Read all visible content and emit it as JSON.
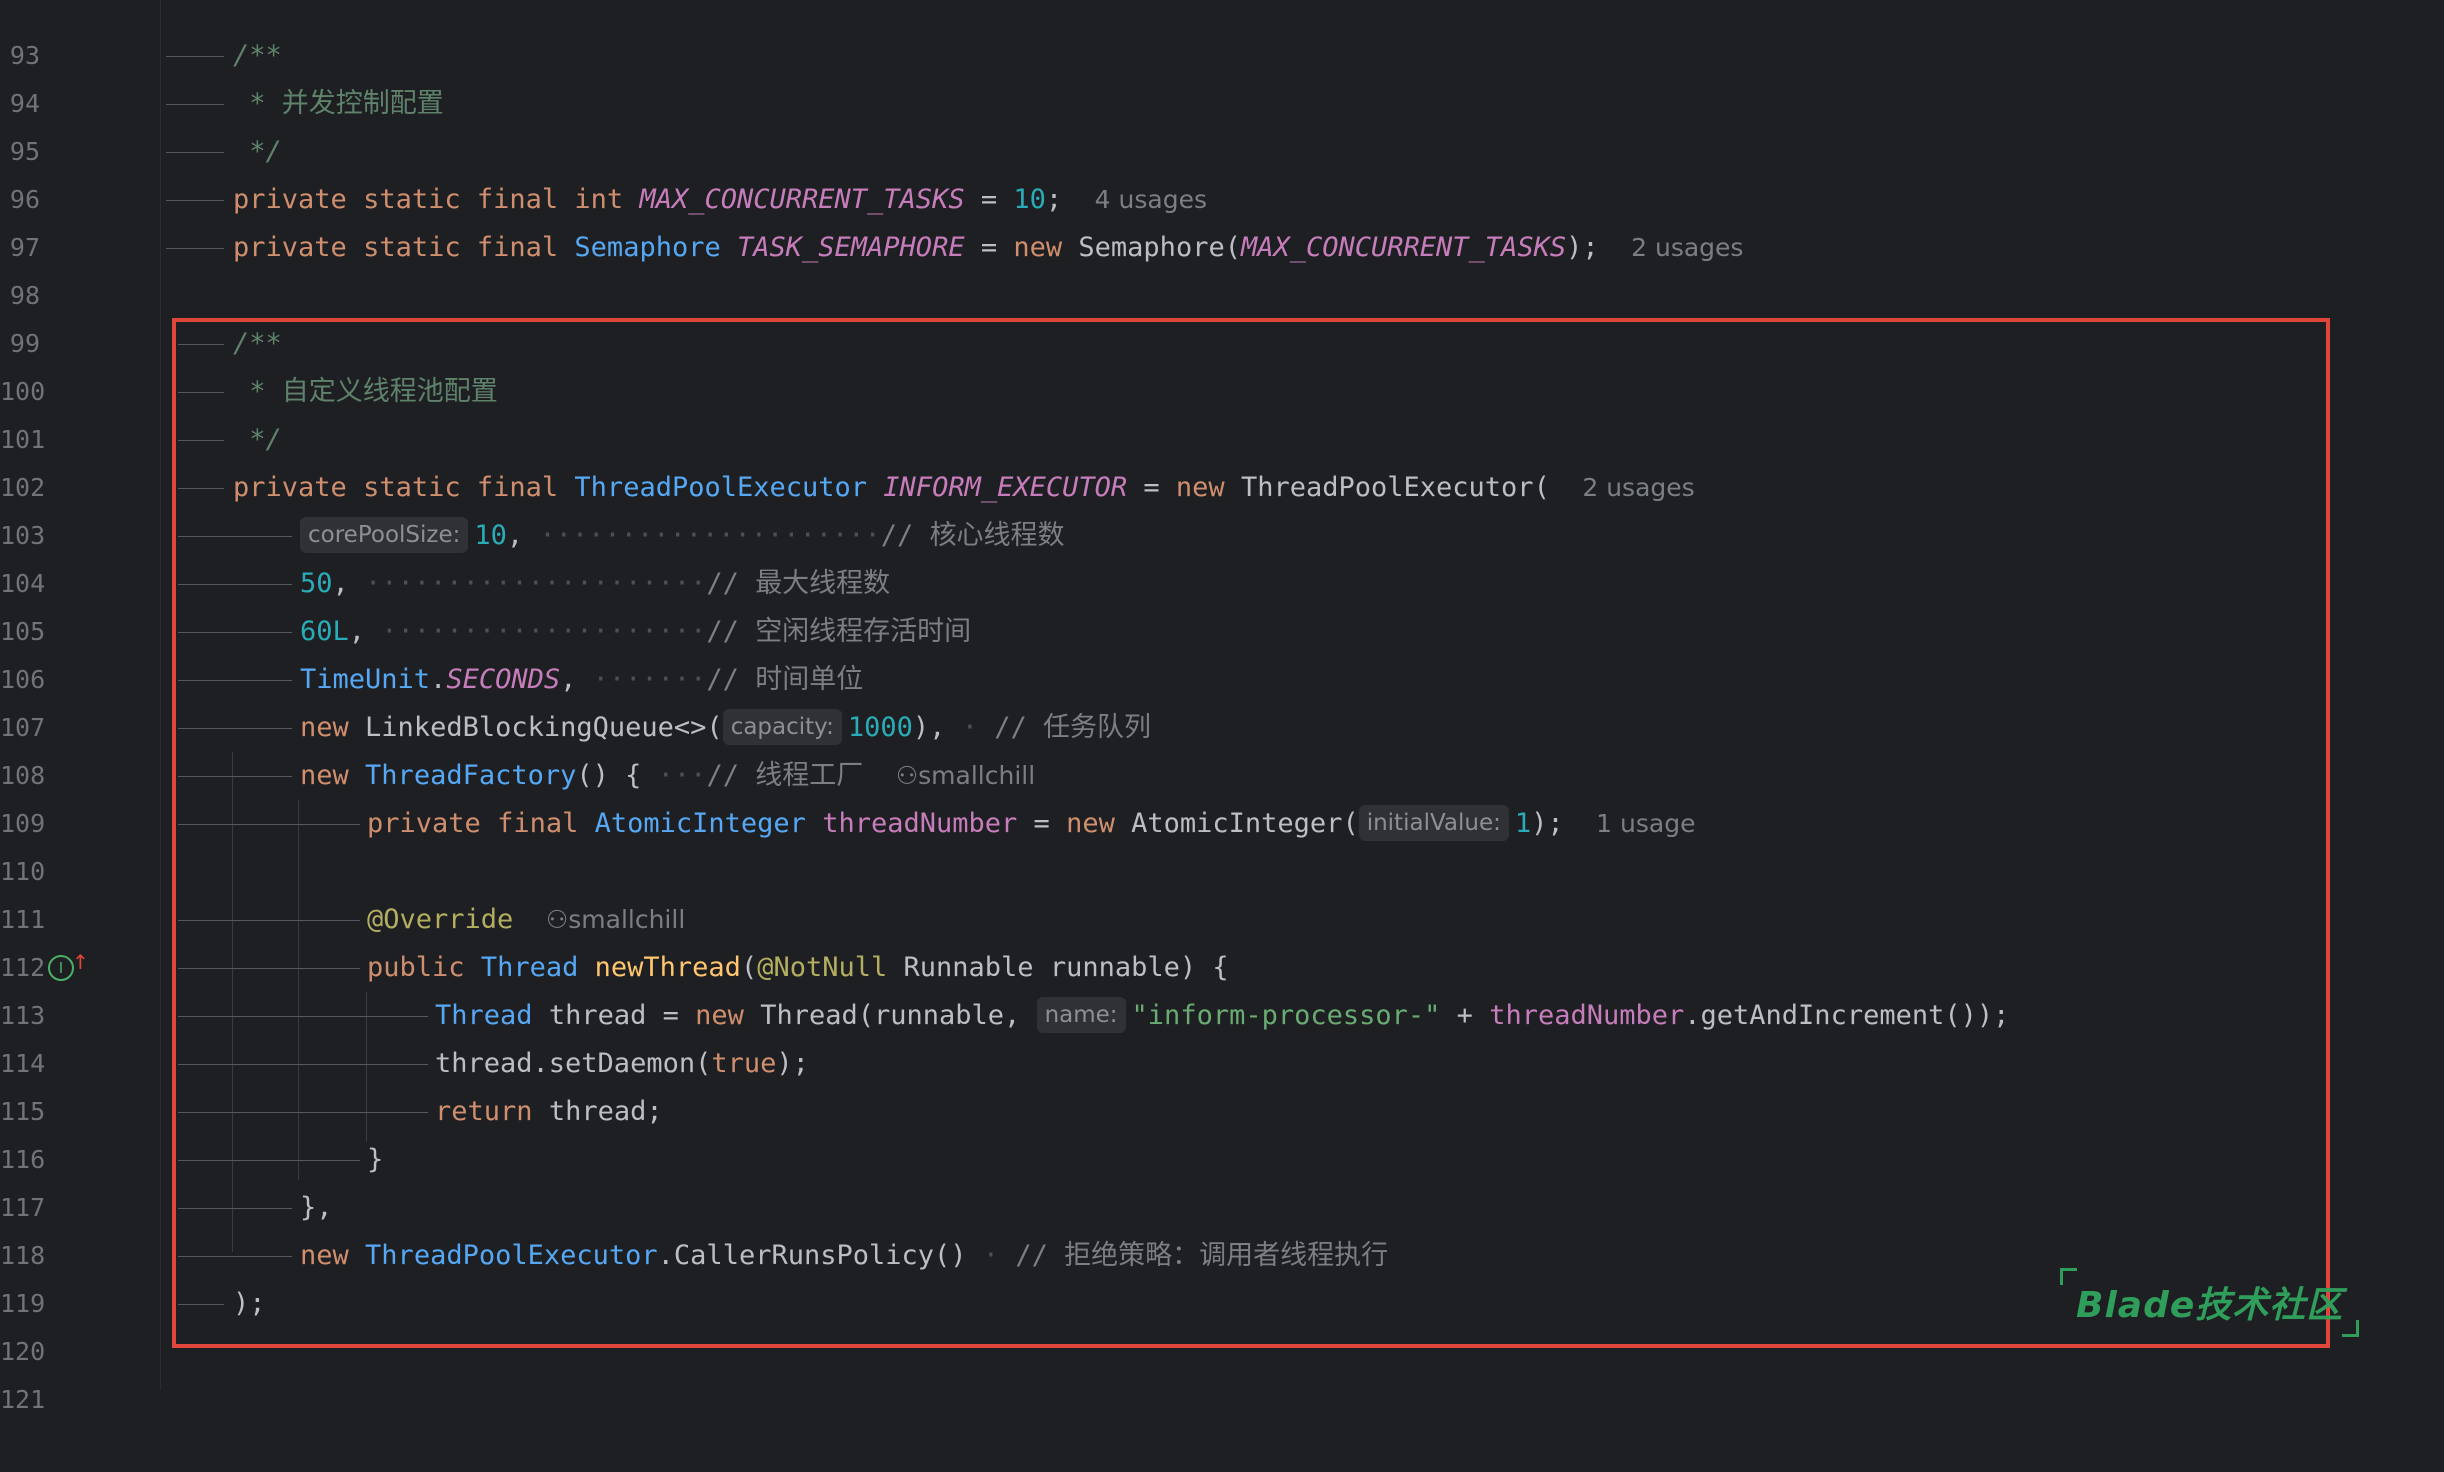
{
  "editor": {
    "line_numbers": [
      "93",
      "94",
      "95",
      "96",
      "97",
      "98",
      "99",
      "100",
      "101",
      "102",
      "103",
      "104",
      "105",
      "106",
      "107",
      "108",
      "109",
      "110",
      "111",
      "112",
      "113",
      "114",
      "115",
      "116",
      "117",
      "118",
      "119",
      "120",
      "121"
    ],
    "doc_open": "/**",
    "doc_close": " */",
    "doc_star": " * ",
    "doc_concurrency": "并发控制配置",
    "doc_threadpool": "自定义线程池配置",
    "kw_private": "private",
    "kw_static": "static",
    "kw_final": "final",
    "kw_int": "int",
    "kw_new": "new",
    "kw_public": "public",
    "kw_return": "return",
    "kw_true": "true",
    "const_max_tasks": "MAX_CONCURRENT_TASKS",
    "const_semaphore": "TASK_SEMAPHORE",
    "const_executor": "INFORM_EXECUTOR",
    "const_seconds": "SECONDS",
    "type_semaphore": "Semaphore",
    "type_executor": "ThreadPoolExecutor",
    "type_timeunit": "TimeUnit",
    "type_linkedqueue": "LinkedBlockingQueue",
    "type_threadfactory": "ThreadFactory",
    "type_atomicinteger": "AtomicInteger",
    "type_thread": "Thread",
    "type_runnable": "Runnable",
    "annotation_override": "@Override",
    "annotation_notnull": "@NotNull",
    "num_10": "10",
    "num_50": "50",
    "num_60L": "60L",
    "num_1000": "1000",
    "num_1": "1",
    "field_threadnumber": "threadNumber",
    "method_newthread": "newThread",
    "var_thread": "thread",
    "var_runnable": "runnable",
    "str_prefix": "\"inform-processor-\"",
    "call_getandincrement": ".getAndIncrement());",
    "call_setdaemon": "thread.setDaemon(",
    "call_callerruns": "CallerRunsPolicy()",
    "hint_corepoolsize": "corePoolSize:",
    "hint_capacity": "capacity:",
    "hint_initialvalue": "initialValue:",
    "hint_name": "name:",
    "usage_4": "4 usages",
    "usage_2": "2 usages",
    "usage_1": "1 usage",
    "author": "smallchill",
    "cmt_core": "核心线程数",
    "cmt_max": "最大线程数",
    "cmt_idle": "空闲线程存活时间",
    "cmt_unit": "时间单位",
    "cmt_queue": "任务队列",
    "cmt_factory": "线程工厂",
    "cmt_policy": "拒绝策略：调用者线程执行",
    "cmt_prefix": "// "
  },
  "watermark": {
    "text": "Blade技术社区"
  },
  "colors": {
    "highlight_box": "#e0463a",
    "watermark": "#2f9e5a"
  }
}
